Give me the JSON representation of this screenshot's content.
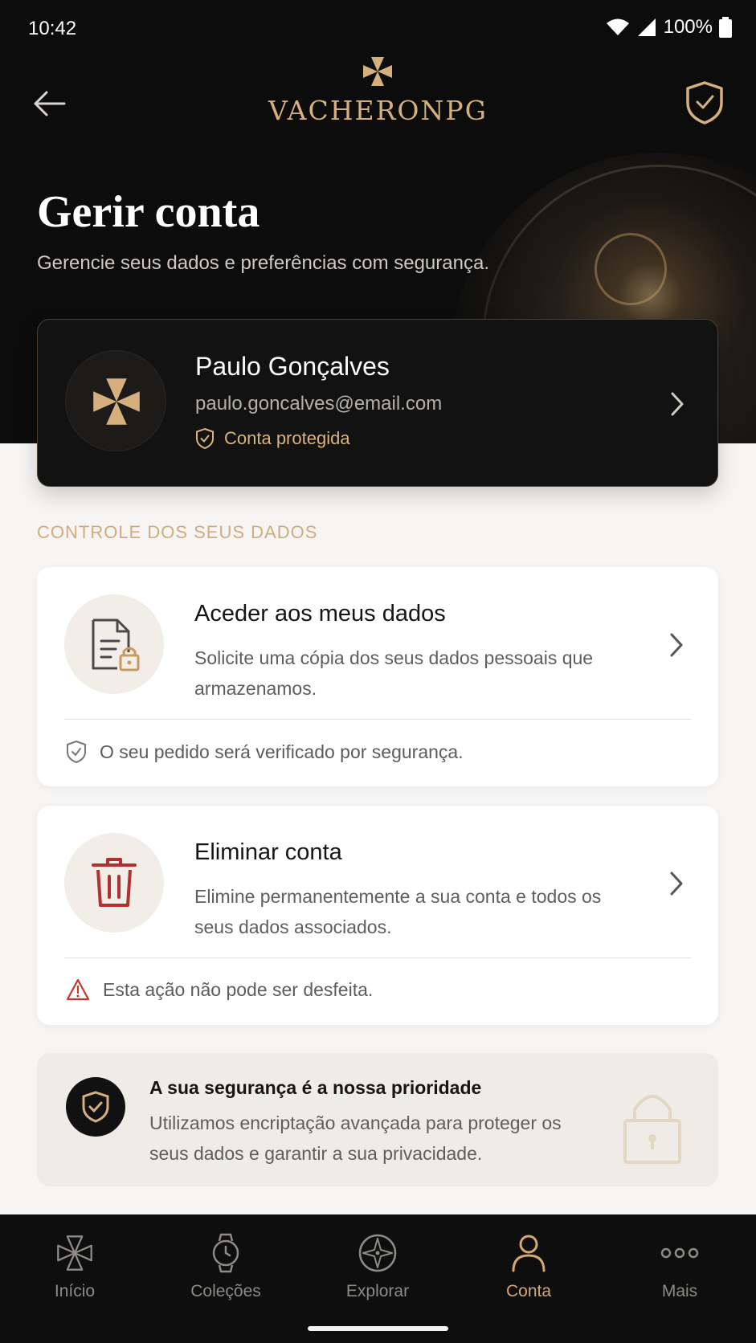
{
  "status_bar": {
    "time": "10:42",
    "battery": "100%"
  },
  "header": {
    "brand": "VACHERONPG"
  },
  "page": {
    "title": "Gerir conta",
    "subtitle": "Gerencie seus dados e preferências com segurança."
  },
  "profile": {
    "name": "Paulo Gonçalves",
    "email": "paulo.goncalves@email.com",
    "badge": "Conta protegida"
  },
  "section": {
    "label": "CONTROLE DOS SEUS DADOS"
  },
  "cards": [
    {
      "title": "Aceder aos meus dados",
      "description": "Solicite uma cópia dos seus dados pessoais que armazenamos.",
      "footnote": "O seu pedido será verificado por segurança."
    },
    {
      "title": "Eliminar conta",
      "description": "Elimine permanentemente a sua conta e todos os seus dados associados.",
      "footnote": "Esta ação não pode ser desfeita."
    }
  ],
  "security_note": {
    "title": "A sua segurança é a nossa prioridade",
    "description": "Utilizamos encriptação avançada para proteger os seus dados e garantir a sua privacidade."
  },
  "nav": {
    "items": [
      {
        "label": "Início",
        "icon": "maltese-cross-icon"
      },
      {
        "label": "Coleções",
        "icon": "watch-icon"
      },
      {
        "label": "Explorar",
        "icon": "compass-icon"
      },
      {
        "label": "Conta",
        "icon": "user-icon"
      },
      {
        "label": "Mais",
        "icon": "more-dots-icon"
      }
    ],
    "active": "Conta"
  },
  "colors": {
    "accent": "#d5a96d",
    "danger": "#b3302e",
    "hero_bg": "#0c0c0c"
  }
}
